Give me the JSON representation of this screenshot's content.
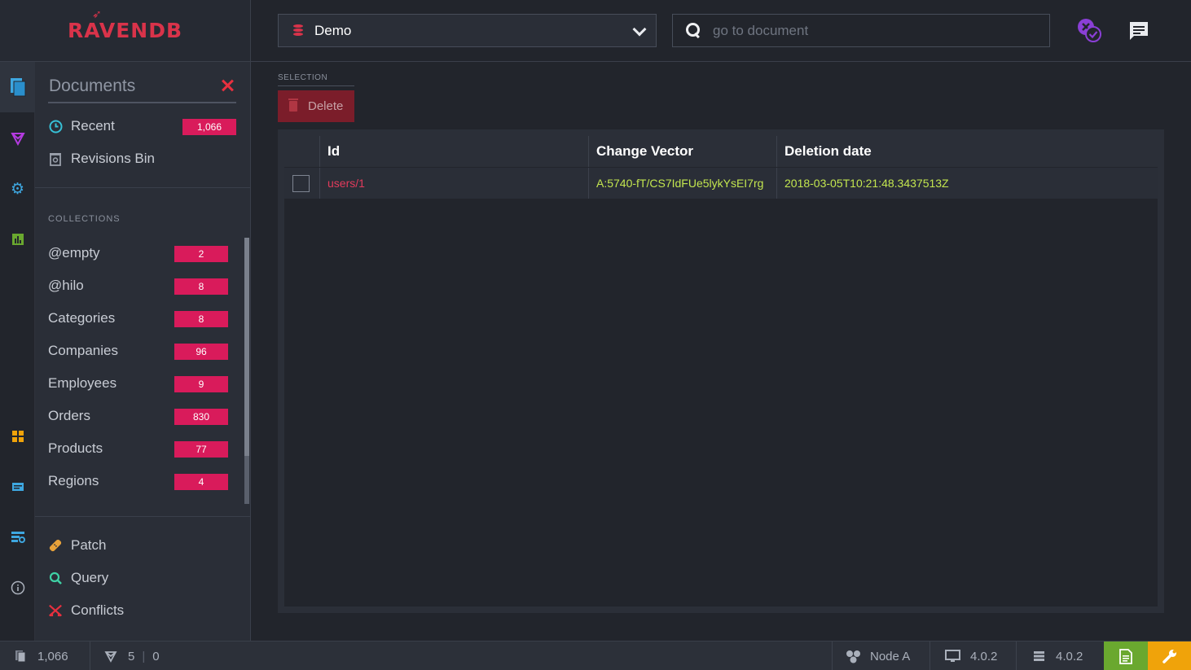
{
  "app": {
    "logo_text": "RAVENDB"
  },
  "topbar": {
    "database_name": "Demo",
    "search_placeholder": "go to document"
  },
  "panel": {
    "title": "Documents",
    "recent_label": "Recent",
    "recent_count": "1,066",
    "revisions_bin_label": "Revisions Bin",
    "collections_heading": "COLLECTIONS",
    "collections": [
      {
        "name": "@empty",
        "count": "2"
      },
      {
        "name": "@hilo",
        "count": "8"
      },
      {
        "name": "Categories",
        "count": "8"
      },
      {
        "name": "Companies",
        "count": "96"
      },
      {
        "name": "Employees",
        "count": "9"
      },
      {
        "name": "Orders",
        "count": "830"
      },
      {
        "name": "Products",
        "count": "77"
      },
      {
        "name": "Regions",
        "count": "4"
      }
    ],
    "tools": [
      {
        "label": "Patch"
      },
      {
        "label": "Query"
      },
      {
        "label": "Conflicts"
      }
    ]
  },
  "main": {
    "selection_label": "SELECTION",
    "delete_label": "Delete",
    "columns": [
      "Id",
      "Change Vector",
      "Deletion date"
    ],
    "rows": [
      {
        "id": "users/1",
        "change_vector": "A:5740-fT/CS7IdFUe5lykYsEI7rg",
        "deletion_date": "2018-03-05T10:21:48.3437513Z"
      }
    ]
  },
  "statusbar": {
    "doc_count": "1,066",
    "index_count": "5",
    "index_errors": "0",
    "node": "Node A",
    "client_version": "4.0.2",
    "server_version": "4.0.2"
  },
  "colors": {
    "accent": "#d91b5b",
    "link": "#e33b5c",
    "value": "#c3e64f",
    "danger": "#8b1c2a",
    "status_green": "#6aa82f",
    "status_orange": "#f0a30a"
  }
}
